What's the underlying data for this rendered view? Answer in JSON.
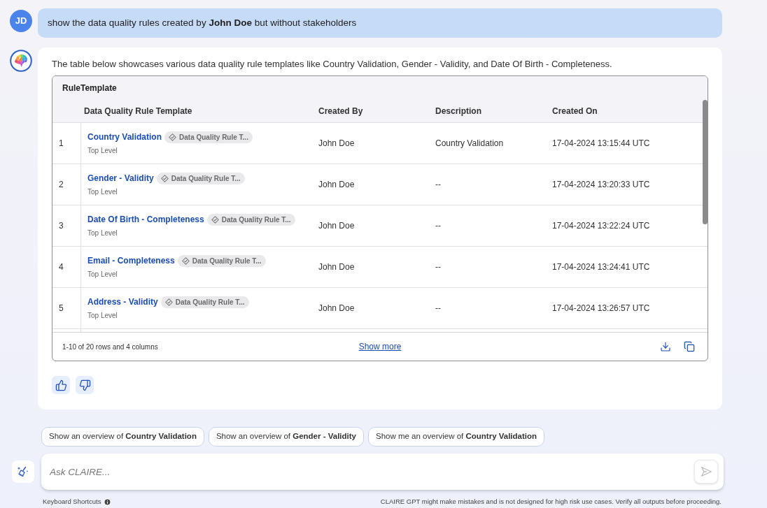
{
  "user_message": {
    "avatar_initials": "JD",
    "text": "show the data quality rules created by **John Doe** but without stakeholders"
  },
  "assistant_message": {
    "intro": "The table below showcases various data quality rule templates like Country Validation, Gender - Validity, and Date Of Birth - Completeness.",
    "table": {
      "title": "RuleTemplate",
      "columns": [
        "Data Quality Rule Template",
        "Created By",
        "Description",
        "Created On"
      ],
      "rows": [
        {
          "index": "1",
          "name": "Country Validation",
          "tag": "Data Quality Rule T...",
          "level": "Top Level",
          "created_by": "John Doe",
          "description": "Country Validation",
          "created_on": "17-04-2024 13:15:44 UTC"
        },
        {
          "index": "2",
          "name": "Gender - Validity",
          "tag": "Data Quality Rule T...",
          "level": "Top Level",
          "created_by": "John Doe",
          "description": "--",
          "created_on": "17-04-2024 13:20:33 UTC"
        },
        {
          "index": "3",
          "name": "Date Of Birth - Completeness",
          "tag": "Data Quality Rule T...",
          "level": "Top Level",
          "created_by": "John Doe",
          "description": "--",
          "created_on": "17-04-2024 13:22:24 UTC"
        },
        {
          "index": "4",
          "name": "Email - Completeness",
          "tag": "Data Quality Rule T...",
          "level": "Top Level",
          "created_by": "John Doe",
          "description": "--",
          "created_on": "17-04-2024 13:24:41 UTC"
        },
        {
          "index": "5",
          "name": "Address - Validity",
          "tag": "Data Quality Rule T...",
          "level": "Top Level",
          "created_by": "John Doe",
          "description": "--",
          "created_on": "17-04-2024 13:26:57 UTC"
        }
      ],
      "summary": "1-10 of 20 rows and 4 columns",
      "show_more": "Show more"
    }
  },
  "suggestions": [
    "Show an overview of **Country Validation**",
    "Show an overview of **Gender - Validity**",
    "Show me an overview of **Country Validation**"
  ],
  "composer": {
    "placeholder": "Ask CLAIRE..."
  },
  "footer": {
    "shortcuts": "Keyboard Shortcuts",
    "disclaimer": "CLAIRE GPT might make mistakes and is not designed for high risk use cases. Verify all outputs before proceeding."
  }
}
